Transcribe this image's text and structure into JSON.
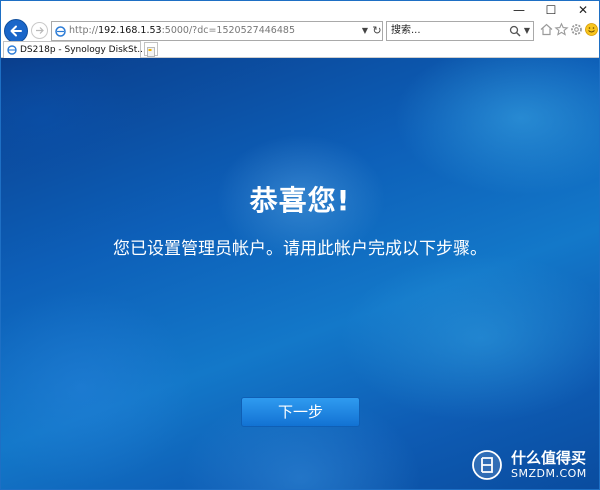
{
  "window": {
    "minimize_glyph": "—",
    "maximize_glyph": "☐",
    "close_glyph": "✕"
  },
  "navbar": {
    "address": {
      "scheme": "http://",
      "host": "192.168.1.53",
      "rest": ":5000/?dc=1520527446485"
    },
    "search_placeholder": "搜索...",
    "icons": [
      "back-arrow-icon",
      "forward-arrow-icon",
      "search-icon",
      "home-icon",
      "star-icon",
      "gear-icon",
      "smiley-icon"
    ]
  },
  "tabs": [
    {
      "label": "DS218p - Synology DiskSt..."
    }
  ],
  "content": {
    "title": "恭喜您!",
    "subtitle": "您已设置管理员帐户。请用此帐户完成以下步骤。",
    "next_button": "下一步"
  },
  "watermark": {
    "name": "什么值得买",
    "sub": "SMZDM.COM"
  },
  "colors": {
    "accent": "#1a66c9",
    "button": "#1f86e0",
    "background": "#0d5fb8"
  }
}
